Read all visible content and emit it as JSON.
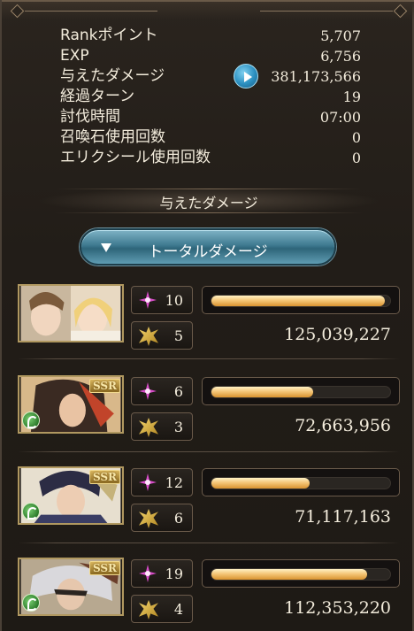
{
  "stats": [
    {
      "label": "Rankポイント",
      "value": "5,707"
    },
    {
      "label": "EXP",
      "value": "6,756"
    },
    {
      "label": "与えたダメージ",
      "value": "381,173,566"
    },
    {
      "label": "経過ターン",
      "value": "19"
    },
    {
      "label": "討伐時間",
      "value": "07:00"
    },
    {
      "label": "召喚石使用回数",
      "value": "0"
    },
    {
      "label": "エリクシール使用回数",
      "value": "0"
    }
  ],
  "section_title": "与えたダメージ",
  "dropdown": {
    "label": "トータルダメージ",
    "icon": "triangle-down-icon"
  },
  "colors": {
    "accent_blue": "#3f7a90",
    "gauge": "#f4c678",
    "star": "#d84cc9"
  },
  "characters": [
    {
      "turns": "10",
      "ougi": "5",
      "damage": "125,039,227",
      "gauge_fill": 0.97,
      "ssr": false,
      "element": false
    },
    {
      "turns": "6",
      "ougi": "3",
      "damage": "72,663,956",
      "gauge_fill": 0.57,
      "ssr": true,
      "ssr_label": "SSR",
      "element": true
    },
    {
      "turns": "12",
      "ougi": "6",
      "damage": "71,117,163",
      "gauge_fill": 0.55,
      "ssr": true,
      "ssr_label": "SSR",
      "element": true
    },
    {
      "turns": "19",
      "ougi": "4",
      "damage": "112,353,220",
      "gauge_fill": 0.87,
      "ssr": true,
      "ssr_label": "SSR",
      "element": true
    }
  ]
}
